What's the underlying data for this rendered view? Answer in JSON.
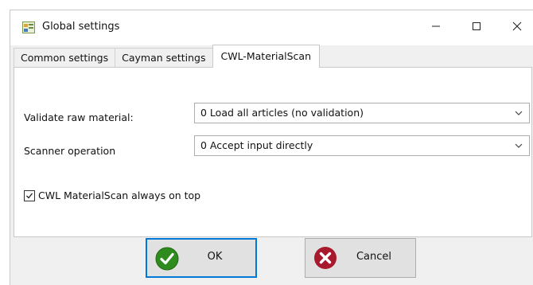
{
  "window": {
    "title": "Global settings",
    "controls": {
      "minimize_icon": "minimize-icon",
      "maximize_icon": "maximize-icon",
      "close_icon": "close-icon"
    }
  },
  "tabs": [
    {
      "label": "Common settings",
      "active": false
    },
    {
      "label": "Cayman settings",
      "active": false
    },
    {
      "label": "CWL-MaterialScan",
      "active": true
    }
  ],
  "fields": {
    "validate_raw_material": {
      "label": "Validate raw material:",
      "value": "0 Load all articles (no validation)"
    },
    "scanner_operation": {
      "label": "Scanner operation",
      "value": "0 Accept input directly"
    },
    "always_on_top": {
      "label": "CWL MaterialScan always on top",
      "checked": true
    }
  },
  "buttons": {
    "ok": {
      "label": "OK",
      "icon": "checkmark-icon",
      "color": "#2e8b1e"
    },
    "cancel": {
      "label": "Cancel",
      "icon": "cross-icon",
      "color": "#a8192e"
    }
  },
  "colors": {
    "focus_border": "#0078d7"
  }
}
